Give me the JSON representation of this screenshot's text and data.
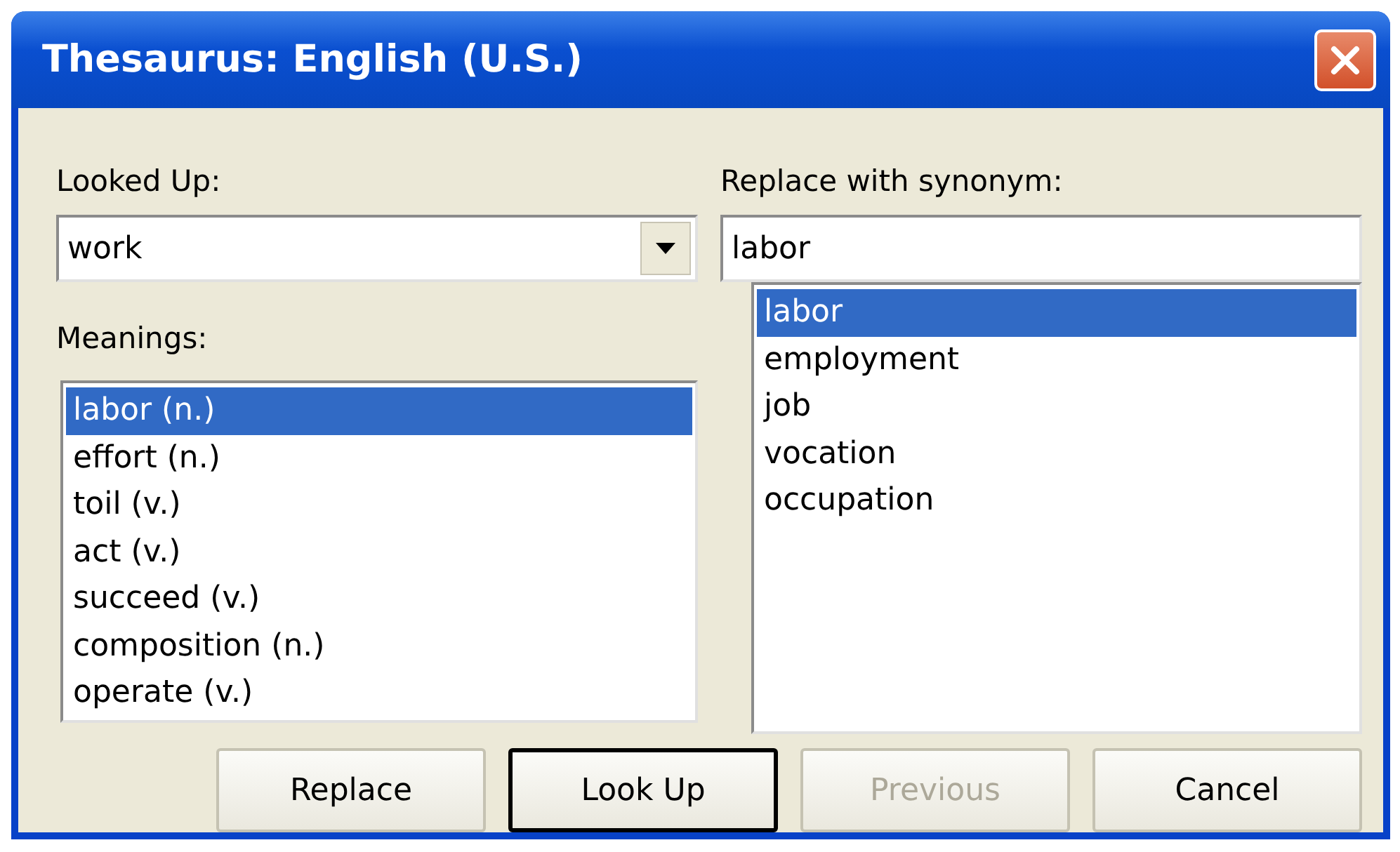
{
  "window": {
    "title": "Thesaurus: English (U.S.)"
  },
  "looked_up": {
    "label": "Looked Up:",
    "value": "work"
  },
  "meanings": {
    "label": "Meanings:",
    "items": [
      {
        "text": "labor (n.)",
        "selected": true
      },
      {
        "text": "effort (n.)",
        "selected": false
      },
      {
        "text": "toil (v.)",
        "selected": false
      },
      {
        "text": "act (v.)",
        "selected": false
      },
      {
        "text": "succeed (v.)",
        "selected": false
      },
      {
        "text": "composition (n.)",
        "selected": false
      },
      {
        "text": "operate (v.)",
        "selected": false
      }
    ]
  },
  "synonym": {
    "label": "Replace with synonym:",
    "value": "labor",
    "items": [
      {
        "text": "labor",
        "selected": true
      },
      {
        "text": "employment",
        "selected": false
      },
      {
        "text": "job",
        "selected": false
      },
      {
        "text": "vocation",
        "selected": false
      },
      {
        "text": "occupation",
        "selected": false
      }
    ]
  },
  "buttons": [
    {
      "label": "Replace",
      "default": false,
      "disabled": false
    },
    {
      "label": "Look Up",
      "default": true,
      "disabled": false
    },
    {
      "label": "Previous",
      "default": false,
      "disabled": true
    },
    {
      "label": "Cancel",
      "default": false,
      "disabled": false
    }
  ]
}
